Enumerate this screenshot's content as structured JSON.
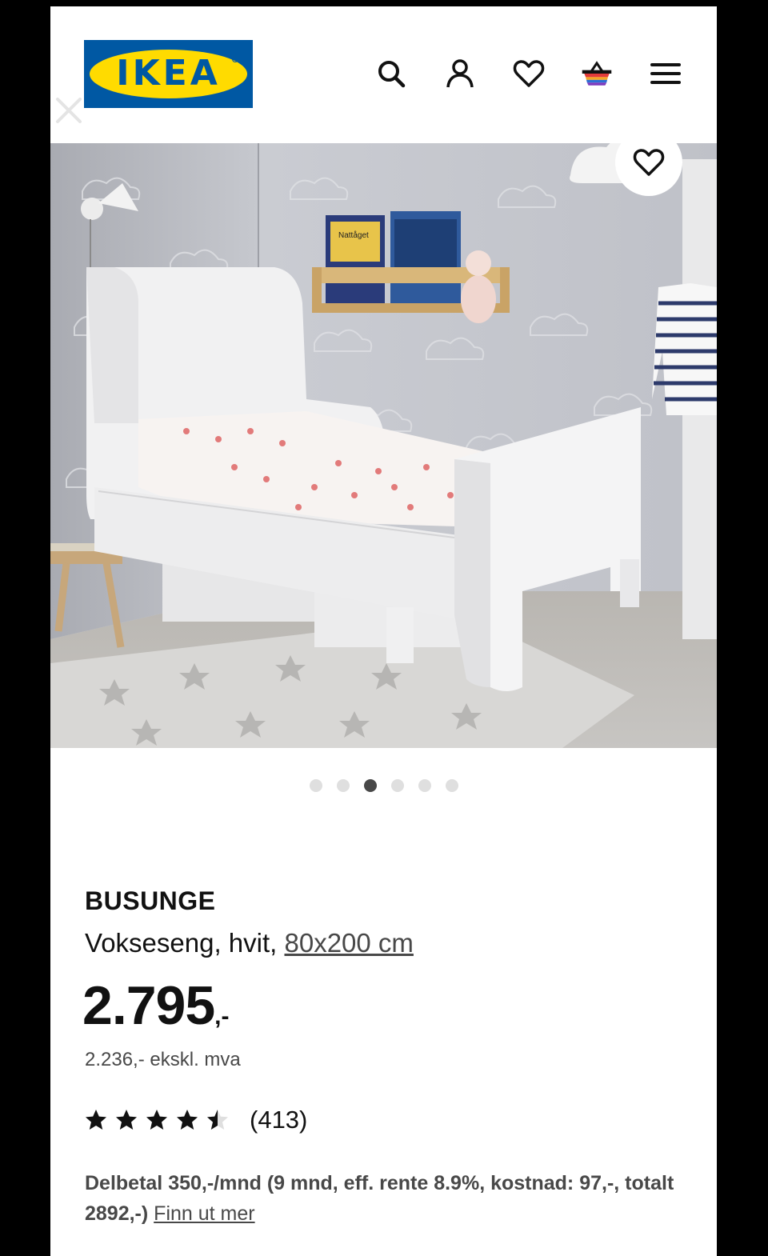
{
  "header": {
    "logo_text": "IKEA",
    "icons": [
      "search-icon",
      "user-icon",
      "heart-icon",
      "basket-icon",
      "menu-icon"
    ]
  },
  "gallery": {
    "book_title": "Nattåget",
    "dots_count": 6,
    "active_dot": 3
  },
  "product": {
    "name": "BUSUNGE",
    "description": "Vokseseng, hvit, ",
    "size_link": "80x200 cm",
    "price_main": "2.795",
    "price_suffix": ",-",
    "price_ex_vat": "2.236,- ekskl. mva",
    "rating": 4.5,
    "rating_count": "(413)",
    "financing_text": "Delbetal 350,-/mnd (9 mnd, eff. rente 8.9%, kostnad: 97,-, totalt 2892,-) ",
    "financing_link": "Finn ut mer"
  },
  "colors": {
    "brand_blue": "#0058a3",
    "brand_yellow": "#ffdb00",
    "text": "#111111",
    "secondary_text": "#484848"
  }
}
